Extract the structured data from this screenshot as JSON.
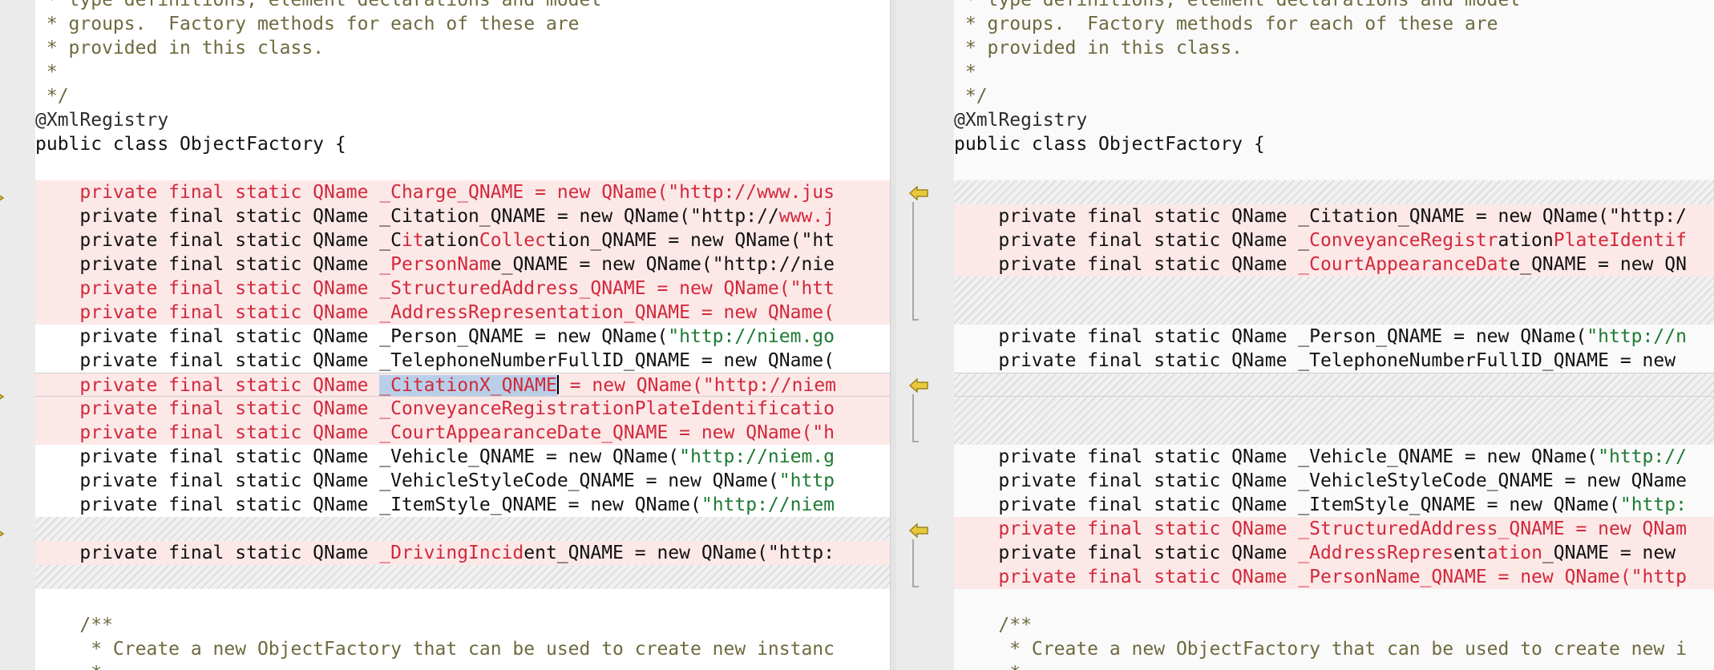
{
  "colors": {
    "deleted_text": "#d1293a",
    "string_literal": "#1e7a33",
    "comment": "#6e6a3f",
    "change_background": "#fde8e8",
    "selection": "#b9cfe8",
    "marker_fill": "#e8c93a"
  },
  "icons": {
    "change_marker": "triangle-arrow",
    "apply_arrow": "left-arrow"
  },
  "left": {
    "lines": [
      {
        "bg": "",
        "segments": [
          {
            "t": " * type definitions, element declarations and model",
            "c": "comment"
          }
        ]
      },
      {
        "bg": "",
        "segments": [
          {
            "t": " * groups.  Factory methods for each of these are",
            "c": "comment"
          }
        ]
      },
      {
        "bg": "",
        "segments": [
          {
            "t": " * provided in this class.",
            "c": "comment"
          }
        ]
      },
      {
        "bg": "",
        "segments": [
          {
            "t": " *",
            "c": "comment"
          }
        ]
      },
      {
        "bg": "",
        "segments": [
          {
            "t": " */",
            "c": "comment"
          }
        ]
      },
      {
        "bg": "",
        "segments": [
          {
            "t": "@XmlRegistry",
            "c": "ann"
          }
        ]
      },
      {
        "bg": "",
        "segments": [
          {
            "t": "public class ObjectFactory {",
            "c": "code"
          }
        ]
      },
      {
        "bg": "",
        "segments": [
          {
            "t": "",
            "c": "code"
          }
        ]
      },
      {
        "bg": "pink",
        "segments": [
          {
            "t": "    private final static QName _Charge_QNAME = new QName(\"http://www.jus",
            "c": "del"
          }
        ]
      },
      {
        "bg": "pink",
        "segments": [
          {
            "t": "    private final static QName _Citation_QNAME = new QName(\"http://",
            "c": "code"
          },
          {
            "t": "www.j",
            "c": "del"
          }
        ]
      },
      {
        "bg": "pink",
        "segments": [
          {
            "t": "    private final static QName _C",
            "c": "code"
          },
          {
            "t": "it",
            "c": "del"
          },
          {
            "t": "ation",
            "c": "code"
          },
          {
            "t": "Collec",
            "c": "del"
          },
          {
            "t": "tion_QNAME = new QName(\"ht",
            "c": "code"
          }
        ]
      },
      {
        "bg": "pink",
        "segments": [
          {
            "t": "    private final static QName ",
            "c": "code"
          },
          {
            "t": "_PersonNam",
            "c": "del"
          },
          {
            "t": "e_QNAME = new QName(\"http://nie",
            "c": "code"
          }
        ]
      },
      {
        "bg": "pink",
        "segments": [
          {
            "t": "    private final static QName _StructuredAddress_QNAME = new QName(\"htt",
            "c": "del"
          }
        ]
      },
      {
        "bg": "pink",
        "segments": [
          {
            "t": "    private final static QName _AddressRepresentation_QNAME = new QName(",
            "c": "del"
          }
        ]
      },
      {
        "bg": "",
        "segments": [
          {
            "t": "    private final static QName _Person_QNAME = new QName(",
            "c": "code"
          },
          {
            "t": "\"http://niem.go",
            "c": "str"
          }
        ]
      },
      {
        "bg": "",
        "segments": [
          {
            "t": "    private final static QName _TelephoneNumberFullID_QNAME = new QName(",
            "c": "code"
          }
        ]
      },
      {
        "bg": "pink-caret",
        "segments": [
          {
            "t": "    private final static QName ",
            "c": "del"
          },
          {
            "t": "_CitationX_QNAME",
            "c": "del hl"
          },
          {
            "t": "",
            "c": "caret"
          },
          {
            "t": " = new QName(\"http://niem",
            "c": "del"
          }
        ]
      },
      {
        "bg": "pink",
        "segments": [
          {
            "t": "    private final static QName _ConveyanceRegistrationPlateIdentificatio",
            "c": "del"
          }
        ]
      },
      {
        "bg": "pink",
        "segments": [
          {
            "t": "    private final static QName _CourtAppearanceDate_QNAME = new QName(\"h",
            "c": "del"
          }
        ]
      },
      {
        "bg": "",
        "segments": [
          {
            "t": "    private final static QName _Vehicle_QNAME = new QName(",
            "c": "code"
          },
          {
            "t": "\"http://niem.g",
            "c": "str"
          }
        ]
      },
      {
        "bg": "",
        "segments": [
          {
            "t": "    private final static QName _VehicleStyleCode_QNAME = new QName(",
            "c": "code"
          },
          {
            "t": "\"http",
            "c": "str"
          }
        ]
      },
      {
        "bg": "",
        "segments": [
          {
            "t": "    private final static QName _ItemStyle_QNAME = new QName(",
            "c": "code"
          },
          {
            "t": "\"http://niem",
            "c": "str"
          }
        ]
      },
      {
        "bg": "hatch",
        "segments": [
          {
            "t": "",
            "c": "code"
          }
        ]
      },
      {
        "bg": "pink",
        "segments": [
          {
            "t": "    private final static QName ",
            "c": "code"
          },
          {
            "t": "_DrivingIncid",
            "c": "del"
          },
          {
            "t": "ent_QNAME = new QName(\"http:",
            "c": "code"
          }
        ]
      },
      {
        "bg": "hatch",
        "segments": [
          {
            "t": "",
            "c": "code"
          }
        ]
      },
      {
        "bg": "",
        "segments": [
          {
            "t": "",
            "c": "code"
          }
        ]
      },
      {
        "bg": "",
        "segments": [
          {
            "t": "    /**",
            "c": "comment"
          }
        ]
      },
      {
        "bg": "",
        "segments": [
          {
            "t": "     * Create a new ObjectFactory that can be used to create new instanc",
            "c": "comment"
          }
        ]
      },
      {
        "bg": "",
        "segments": [
          {
            "t": "     *",
            "c": "comment"
          }
        ]
      }
    ]
  },
  "right": {
    "lines": [
      {
        "bg": "",
        "segments": [
          {
            "t": " * type definitions, element declarations and model",
            "c": "comment"
          }
        ]
      },
      {
        "bg": "",
        "segments": [
          {
            "t": " * groups.  Factory methods for each of these are",
            "c": "comment"
          }
        ]
      },
      {
        "bg": "",
        "segments": [
          {
            "t": " * provided in this class.",
            "c": "comment"
          }
        ]
      },
      {
        "bg": "",
        "segments": [
          {
            "t": " *",
            "c": "comment"
          }
        ]
      },
      {
        "bg": "",
        "segments": [
          {
            "t": " */",
            "c": "comment"
          }
        ]
      },
      {
        "bg": "",
        "segments": [
          {
            "t": "@XmlRegistry",
            "c": "ann"
          }
        ]
      },
      {
        "bg": "",
        "segments": [
          {
            "t": "public class ObjectFactory {",
            "c": "code"
          }
        ]
      },
      {
        "bg": "",
        "segments": [
          {
            "t": "",
            "c": "code"
          }
        ]
      },
      {
        "bg": "hatch",
        "segments": [
          {
            "t": "",
            "c": "code"
          }
        ]
      },
      {
        "bg": "pink",
        "segments": [
          {
            "t": "    private final static QName _Citation_QNAME = new QName(\"http:/",
            "c": "code"
          }
        ]
      },
      {
        "bg": "pink",
        "segments": [
          {
            "t": "    private final static QName _",
            "c": "code"
          },
          {
            "t": "ConveyanceRegistr",
            "c": "del"
          },
          {
            "t": "ation",
            "c": "code"
          },
          {
            "t": "PlateIdentif",
            "c": "del"
          }
        ]
      },
      {
        "bg": "pink",
        "segments": [
          {
            "t": "    private final static QName ",
            "c": "code"
          },
          {
            "t": "_CourtAppearanceDat",
            "c": "del"
          },
          {
            "t": "e_QNAME = new QN",
            "c": "code"
          }
        ]
      },
      {
        "bg": "hatch",
        "segments": [
          {
            "t": "",
            "c": "code"
          }
        ]
      },
      {
        "bg": "hatch",
        "segments": [
          {
            "t": "",
            "c": "code"
          }
        ]
      },
      {
        "bg": "",
        "segments": [
          {
            "t": "    private final static QName _Person_QNAME = new QName(",
            "c": "code"
          },
          {
            "t": "\"http://n",
            "c": "str"
          }
        ]
      },
      {
        "bg": "",
        "segments": [
          {
            "t": "    private final static QName _TelephoneNumberFullID_QNAME = new",
            "c": "code"
          }
        ]
      },
      {
        "bg": "hatch-caret",
        "segments": [
          {
            "t": "",
            "c": "code"
          }
        ]
      },
      {
        "bg": "hatch",
        "segments": [
          {
            "t": "",
            "c": "code"
          }
        ]
      },
      {
        "bg": "hatch",
        "segments": [
          {
            "t": "",
            "c": "code"
          }
        ]
      },
      {
        "bg": "",
        "segments": [
          {
            "t": "    private final static QName _Vehicle_QNAME = new QName(",
            "c": "code"
          },
          {
            "t": "\"http://",
            "c": "str"
          }
        ]
      },
      {
        "bg": "",
        "segments": [
          {
            "t": "    private final static QName _VehicleStyleCode_QNAME = new QName",
            "c": "code"
          }
        ]
      },
      {
        "bg": "",
        "segments": [
          {
            "t": "    private final static QName _ItemStyle_QNAME = new QName(",
            "c": "code"
          },
          {
            "t": "\"http:",
            "c": "str"
          }
        ]
      },
      {
        "bg": "pink",
        "segments": [
          {
            "t": "    private final static QName _StructuredAddress_QNAME = new QNam",
            "c": "del"
          }
        ]
      },
      {
        "bg": "pink",
        "segments": [
          {
            "t": "    private final static QName ",
            "c": "code"
          },
          {
            "t": "_AddressRepres",
            "c": "del"
          },
          {
            "t": "ent",
            "c": "code"
          },
          {
            "t": "ation",
            "c": "del"
          },
          {
            "t": "_QNAME = new",
            "c": "code"
          }
        ]
      },
      {
        "bg": "pink",
        "segments": [
          {
            "t": "    private final static QName _PersonName_QNAME = new QName(\"http",
            "c": "del"
          }
        ]
      },
      {
        "bg": "",
        "segments": [
          {
            "t": "",
            "c": "code"
          }
        ]
      },
      {
        "bg": "",
        "segments": [
          {
            "t": "    /**",
            "c": "comment"
          }
        ]
      },
      {
        "bg": "",
        "segments": [
          {
            "t": "     * Create a new ObjectFactory that can be used to create new i",
            "c": "comment"
          }
        ]
      },
      {
        "bg": "",
        "segments": [
          {
            "t": "     *",
            "c": "comment"
          }
        ]
      }
    ]
  }
}
